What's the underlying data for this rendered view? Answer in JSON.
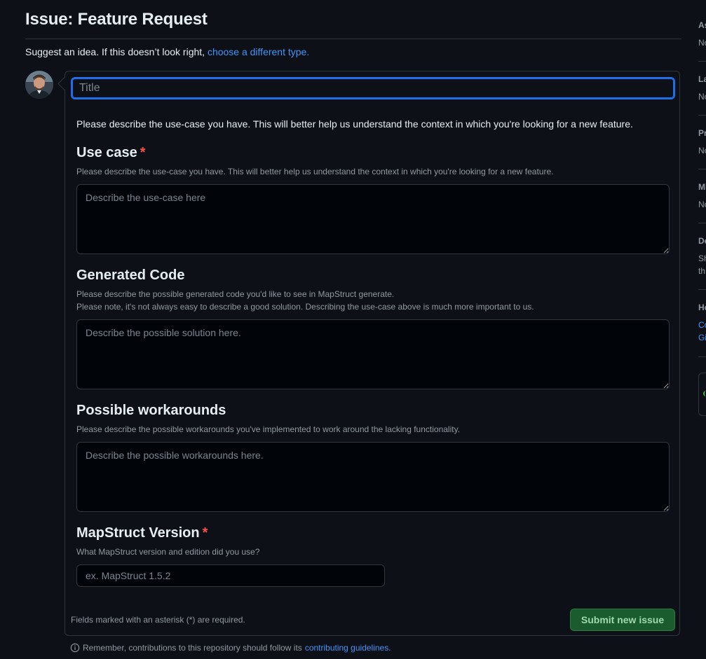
{
  "header": {
    "title": "Issue: Feature Request",
    "subtitle_prefix": "Suggest an idea. If this doesn’t look right,",
    "subtitle_link": "choose a different type."
  },
  "form": {
    "title_placeholder": "Title",
    "intro": "Please describe the use-case you have. This will better help us understand the context in which you're looking for a new feature.",
    "fields": [
      {
        "label": "Use case",
        "required": true,
        "description": "Please describe the use-case you have. This will better help us understand the context in which you're looking for a new feature.",
        "placeholder": "Describe the use-case here"
      },
      {
        "label": "Generated Code",
        "required": false,
        "description_line1": "Please describe the possible generated code you'd like to see in MapStruct generate.",
        "description_line2": "Please note, it's not always easy to describe a good solution. Describing the use-case above is much more important to us.",
        "placeholder": "Describe the possible solution here."
      },
      {
        "label": "Possible workarounds",
        "required": false,
        "description": "Please describe the possible workarounds you've implemented to work around the lacking functionality.",
        "placeholder": "Describe the possible workarounds here."
      },
      {
        "label": "MapStruct Version",
        "required": true,
        "description": "What MapStruct version and edition did you use?",
        "placeholder": "ex. MapStruct 1.5.2"
      }
    ],
    "required_marker": "*",
    "footnote": "Fields marked with an asterisk (*) are required.",
    "submit_label": "Submit new issue"
  },
  "contrib": {
    "prefix": "Remember, contributions to this repository should follow its",
    "link": "contributing guidelines."
  },
  "sidebar": {
    "sections": [
      {
        "head": "As",
        "value": "No"
      },
      {
        "head": "La",
        "value": "No"
      },
      {
        "head": "Pr",
        "value": "No"
      },
      {
        "head": "Mi",
        "value": "No"
      },
      {
        "head": "De",
        "value": "Sh",
        "value2": "th"
      },
      {
        "head": "He",
        "link1": "Co",
        "link2": "Gi"
      }
    ]
  },
  "colors": {
    "accent": "#4493f8",
    "focus_border": "#1f6feb",
    "required": "#f85149",
    "submit_bg": "#1a5c2e"
  }
}
